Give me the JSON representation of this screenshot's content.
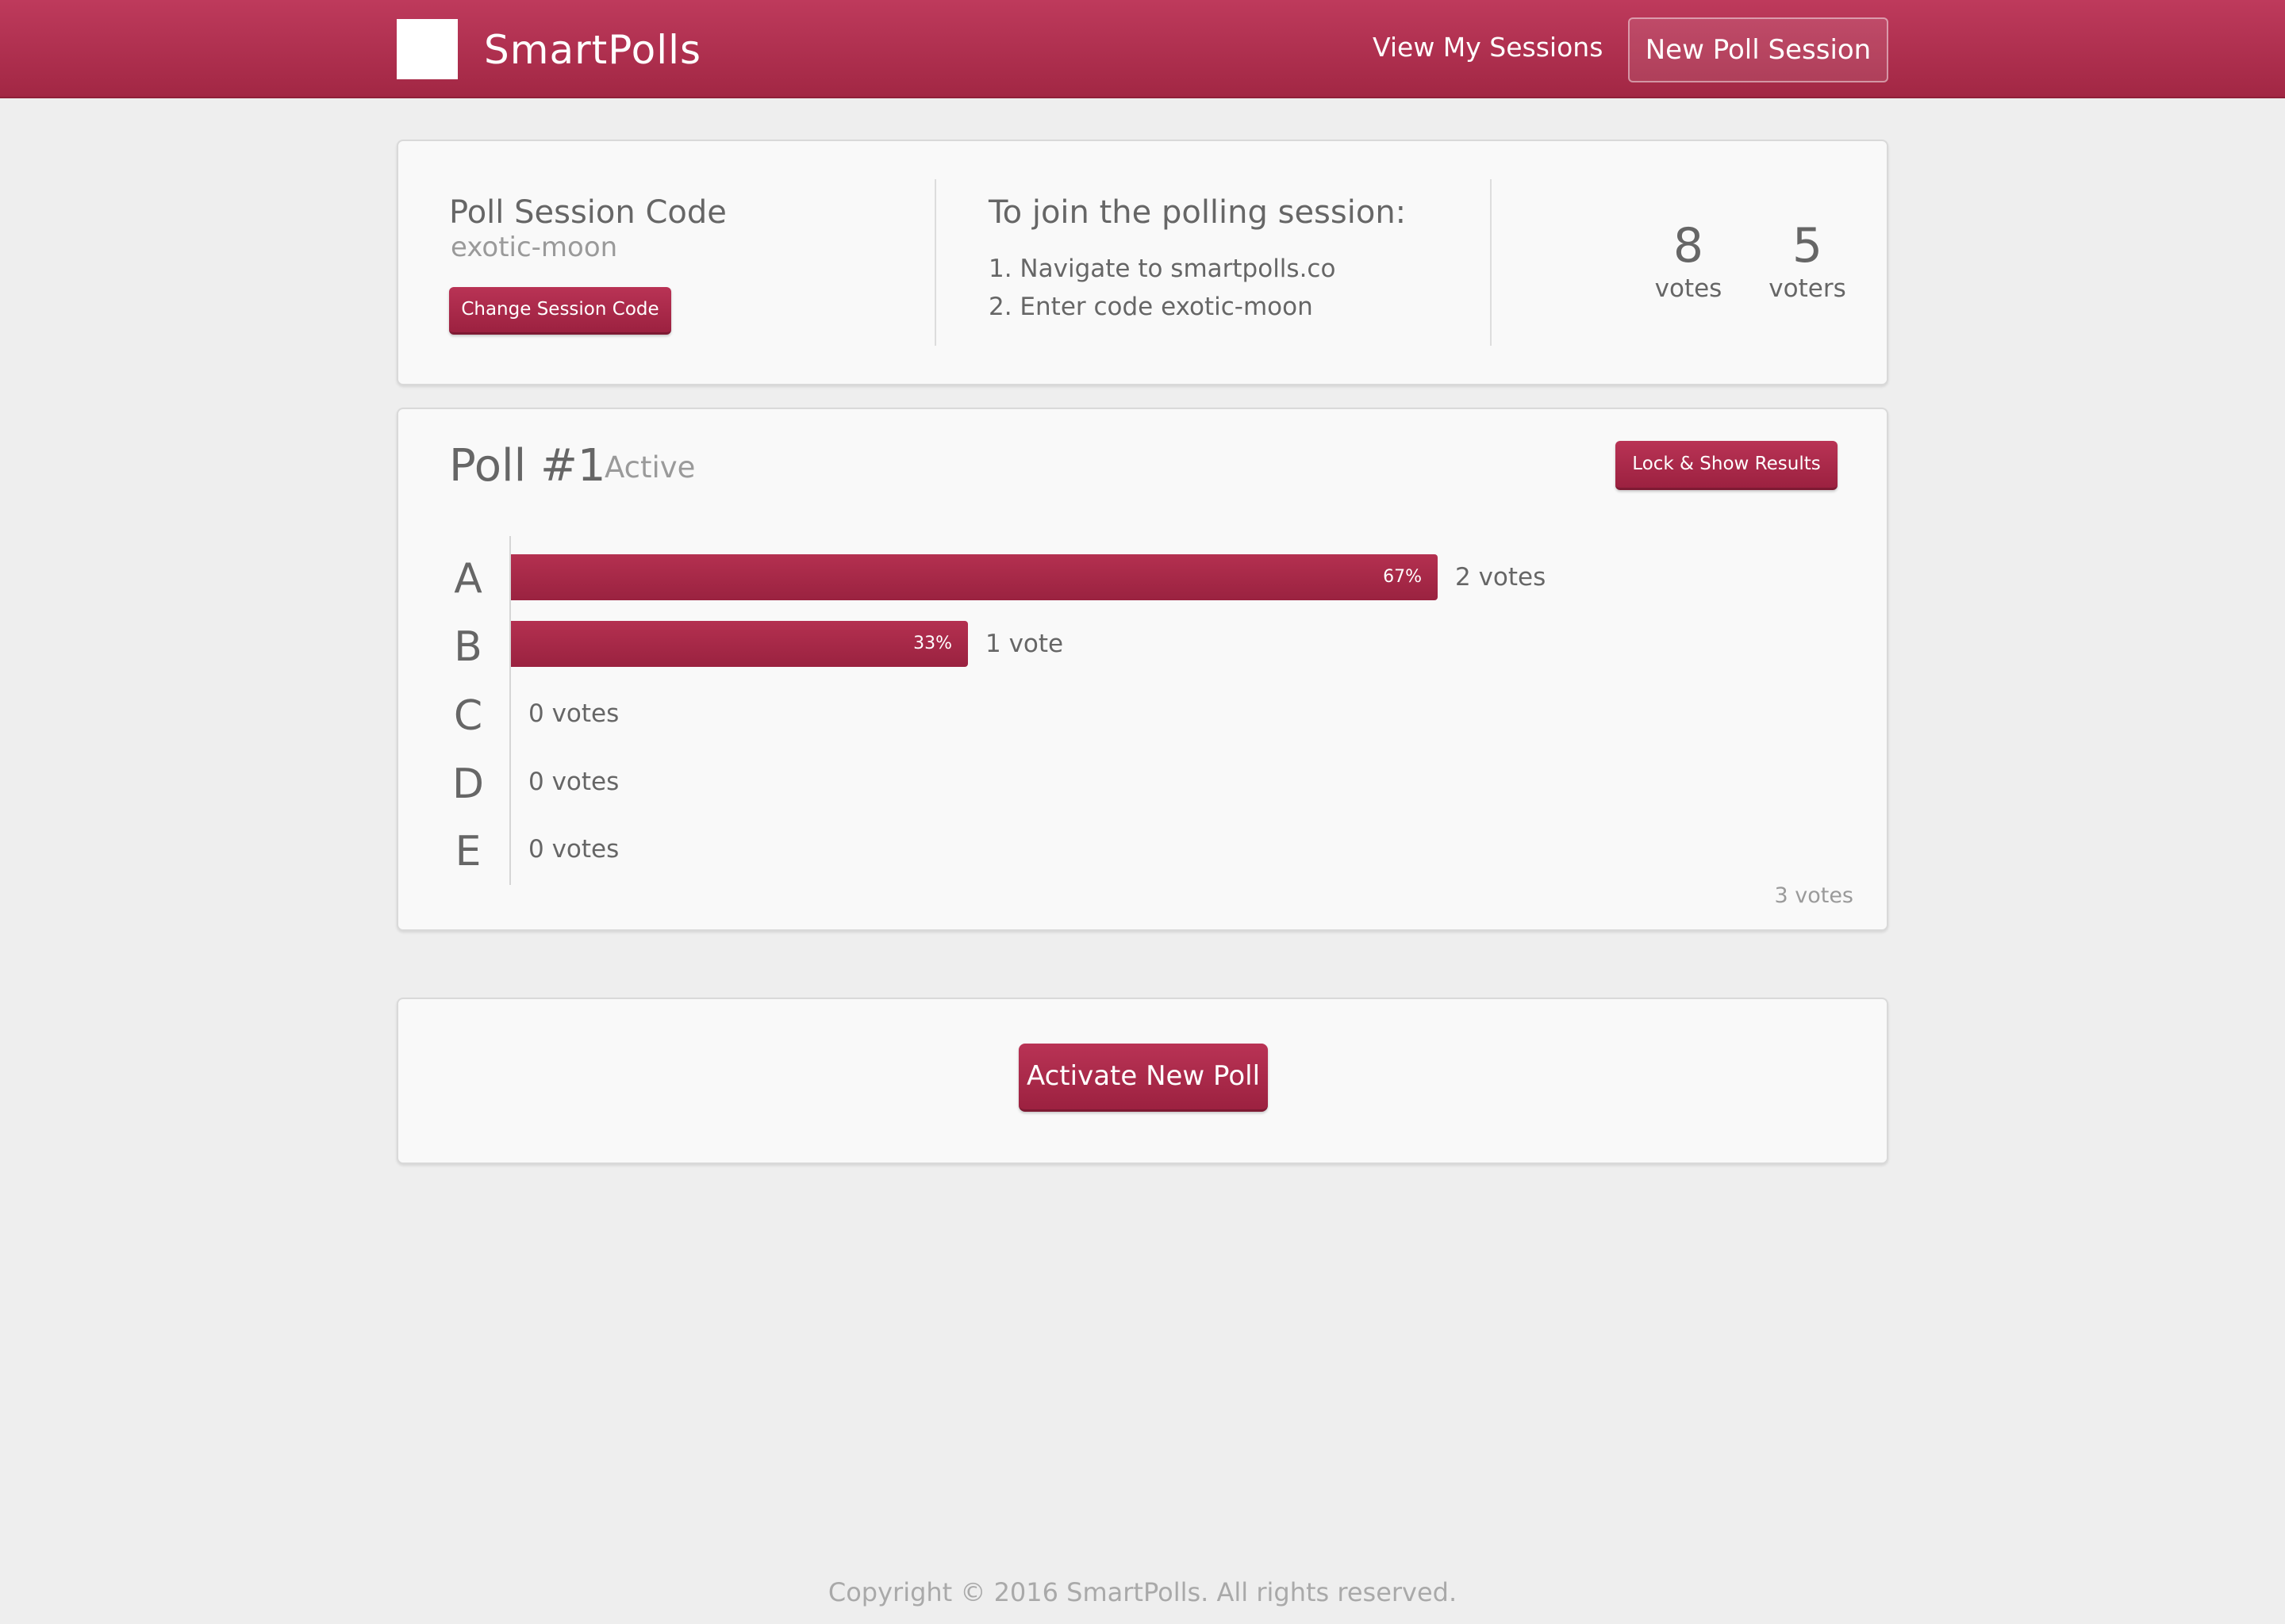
{
  "navbar": {
    "brand": "SmartPolls",
    "view_sessions_label": "View My Sessions",
    "new_session_label": "New Poll Session",
    "color": "#b02e4e"
  },
  "session": {
    "title": "Poll Session Code",
    "code": "exotic-moon",
    "change_button_label": "Change Session Code",
    "join_title": "To join the polling session:",
    "join_steps": [
      "1. Navigate to smartpolls.co",
      "2. Enter code exotic-moon"
    ],
    "stats": [
      {
        "value": "8",
        "label": "votes"
      },
      {
        "value": "5",
        "label": "voters"
      }
    ]
  },
  "poll": {
    "title": "Poll #1",
    "status": "Active",
    "lock_button_label": "Lock & Show Results",
    "options": [
      {
        "letter": "A",
        "fraction": 0.67,
        "pct_label": "67%",
        "votes_label": "2 votes"
      },
      {
        "letter": "B",
        "fraction": 0.33,
        "pct_label": "33%",
        "votes_label": "1 vote"
      },
      {
        "letter": "C",
        "fraction": 0,
        "pct_label": "",
        "votes_label": "0 votes"
      },
      {
        "letter": "D",
        "fraction": 0,
        "pct_label": "",
        "votes_label": "0 votes"
      },
      {
        "letter": "E",
        "fraction": 0,
        "pct_label": "",
        "votes_label": "0 votes"
      }
    ],
    "total_votes_label": "3 votes"
  },
  "activate": {
    "button_label": "Activate New Poll"
  },
  "footer": {
    "text": "Copyright © 2016 SmartPolls. All rights reserved."
  }
}
